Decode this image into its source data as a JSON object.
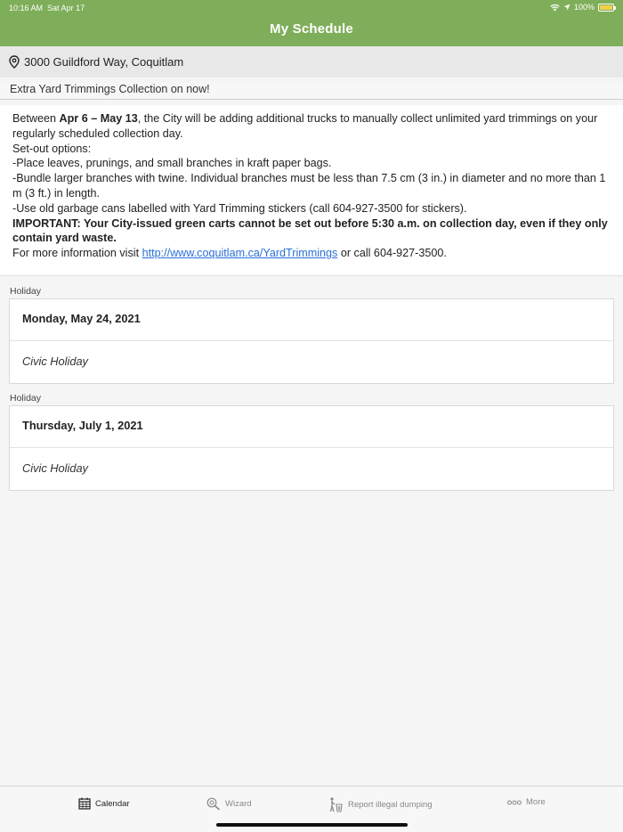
{
  "status": {
    "time": "10:16 AM",
    "date": "Sat Apr 17",
    "battery": "100%",
    "icons": [
      "wifi-icon",
      "location-arrow-icon",
      "battery-charging-icon"
    ]
  },
  "header": {
    "title": "My Schedule"
  },
  "address": {
    "text": "3000 Guildford Way, Coquitlam",
    "icon": "location-pin-icon"
  },
  "notice": {
    "title": "Extra Yard Trimmings Collection on now!",
    "intro_prefix": "Between ",
    "intro_bold": "Apr 6 – May 13",
    "intro_suffix": ", the City will be adding additional trucks to manually collect unlimited yard trimmings on your regularly scheduled collection day.",
    "options_label": "Set-out options:",
    "option1": "-Place leaves, prunings, and small branches in kraft paper bags.",
    "option2": "-Bundle larger branches with twine. Individual branches must be less than 7.5 cm (3 in.) in diameter and no more than 1 m (3 ft.) in length.",
    "option3": "-Use old garbage cans labelled with Yard Trimming stickers (call 604-927-3500 for stickers).",
    "important": "IMPORTANT: Your City-issued green carts cannot be set out before 5:30 a.m. on collection day, even if they only contain yard waste.",
    "more_prefix": "For more information visit ",
    "more_link": "http://www.coquitlam.ca/YardTrimmings",
    "more_suffix": " or call 604-927-3500."
  },
  "holidays": [
    {
      "section": "Holiday",
      "date": "Monday, May 24, 2021",
      "name": "Civic Holiday"
    },
    {
      "section": "Holiday",
      "date": "Thursday, July 1, 2021",
      "name": "Civic Holiday"
    }
  ],
  "tabs": [
    {
      "label": "Calendar",
      "icon": "calendar-icon",
      "active": true
    },
    {
      "label": "Wizard",
      "icon": "search-icon",
      "active": false
    },
    {
      "label": "Report illegal dumping",
      "icon": "dumping-icon",
      "active": false
    },
    {
      "label": "More",
      "icon": "more-icon",
      "active": false
    }
  ],
  "colors": {
    "header": "#7fae5a",
    "link": "#2a6fd6"
  }
}
